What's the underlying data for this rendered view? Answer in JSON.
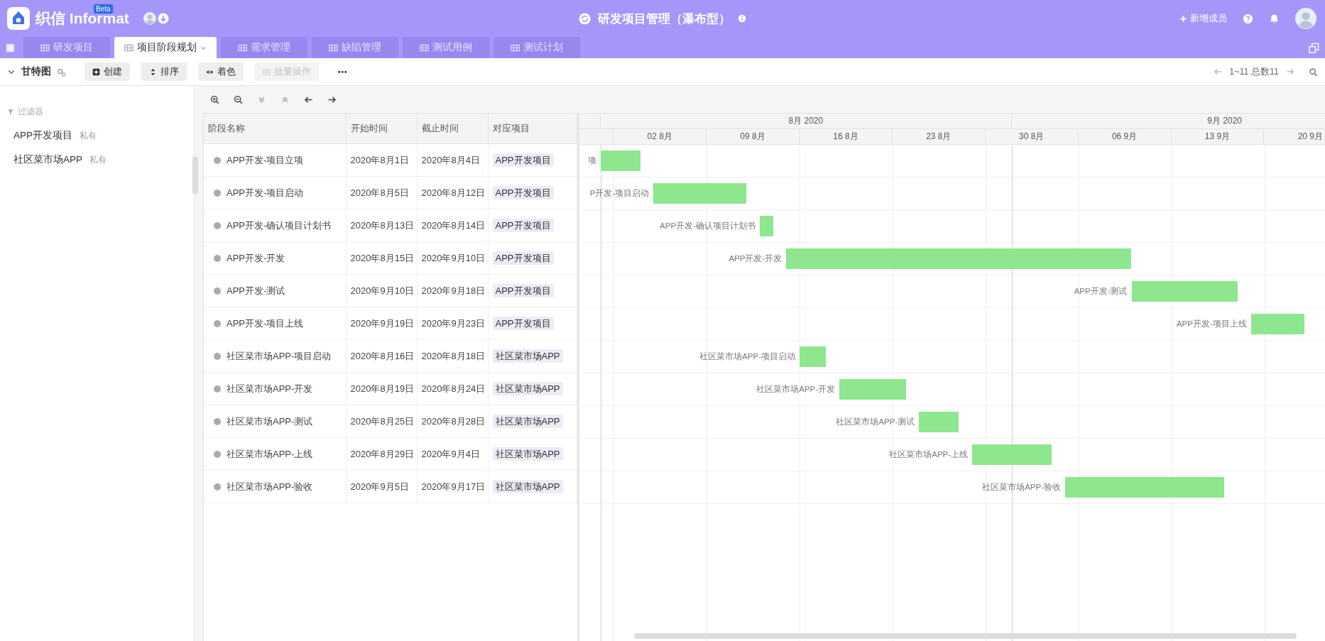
{
  "app": {
    "logo_text": "织信 Informat",
    "badge": "Beta",
    "title": "研发项目管理（瀑布型）",
    "add_member": "新增成员"
  },
  "tabs": [
    {
      "label": "研发项目",
      "selected": false
    },
    {
      "label": "项目阶段规划",
      "selected": true
    },
    {
      "label": "需求管理",
      "selected": false
    },
    {
      "label": "缺陷管理",
      "selected": false
    },
    {
      "label": "测试用例",
      "selected": false
    },
    {
      "label": "测试计划",
      "selected": false
    }
  ],
  "toolbar": {
    "view_name": "甘特图",
    "buttons": [
      {
        "label": "创建",
        "kind": "create",
        "disabled": false
      },
      {
        "label": "排序",
        "kind": "sort",
        "disabled": false
      },
      {
        "label": "着色",
        "kind": "color",
        "disabled": false
      },
      {
        "label": "批量操作",
        "kind": "batch",
        "disabled": true
      },
      {
        "label": "•••",
        "kind": "more",
        "disabled": false
      }
    ],
    "pagination": "1~11 总数11"
  },
  "sidebar": {
    "filter_label": "过滤器",
    "items": [
      {
        "name": "APP开发项目",
        "tag": "私有"
      },
      {
        "name": "社区菜市场APP",
        "tag": "私有"
      }
    ]
  },
  "table": {
    "columns": [
      "阶段名称",
      "开始时间",
      "截止时间",
      "对应项目"
    ],
    "rows": [
      {
        "name": "APP开发-项目立项",
        "start": "2020年8月1日",
        "end": "2020年8月4日",
        "project": "APP开发项目",
        "bar_label": "项"
      },
      {
        "name": "APP开发-项目启动",
        "start": "2020年8月5日",
        "end": "2020年8月12日",
        "project": "APP开发项目",
        "bar_label": "P开发-项目启动"
      },
      {
        "name": "APP开发-确认项目计划书",
        "start": "2020年8月13日",
        "end": "2020年8月14日",
        "project": "APP开发项目",
        "bar_label": "APP开发-确认项目计划书"
      },
      {
        "name": "APP开发-开发",
        "start": "2020年8月15日",
        "end": "2020年9月10日",
        "project": "APP开发项目",
        "bar_label": "APP开发-开发"
      },
      {
        "name": "APP开发-测试",
        "start": "2020年9月10日",
        "end": "2020年9月18日",
        "project": "APP开发项目",
        "bar_label": "APP开发-测试"
      },
      {
        "name": "APP开发-项目上线",
        "start": "2020年9月19日",
        "end": "2020年9月23日",
        "project": "APP开发项目",
        "bar_label": "APP开发-项目上线"
      },
      {
        "name": "社区菜市场APP-项目启动",
        "start": "2020年8月16日",
        "end": "2020年8月18日",
        "project": "社区菜市场APP",
        "bar_label": "社区菜市场APP-项目启动"
      },
      {
        "name": "社区菜市场APP-开发",
        "start": "2020年8月19日",
        "end": "2020年8月24日",
        "project": "社区菜市场APP",
        "bar_label": "社区菜市场APP-开发"
      },
      {
        "name": "社区菜市场APP-测试",
        "start": "2020年8月25日",
        "end": "2020年8月28日",
        "project": "社区菜市场APP",
        "bar_label": "社区菜市场APP-测试"
      },
      {
        "name": "社区菜市场APP-上线",
        "start": "2020年8月29日",
        "end": "2020年9月4日",
        "project": "社区菜市场APP",
        "bar_label": "社区菜市场APP-上线"
      },
      {
        "name": "社区菜市场APP-验收",
        "start": "2020年9月5日",
        "end": "2020年9月17日",
        "project": "社区菜市场APP",
        "bar_label": "社区菜市场APP-验收"
      }
    ]
  },
  "timeline": {
    "months": [
      "8月 2020",
      "9月 2020"
    ],
    "weeks": [
      "02 8月",
      "09 8月",
      "16 8月",
      "23 8月",
      "30 8月",
      "06 9月",
      "13 9月",
      "20 9月"
    ]
  }
}
